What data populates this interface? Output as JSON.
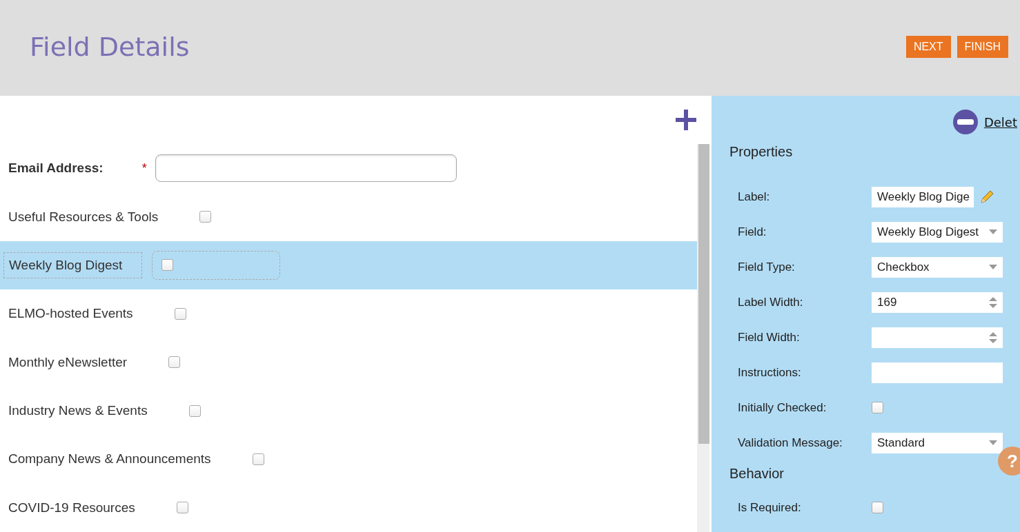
{
  "header": {
    "title": "Field Details",
    "buttons": [
      "NEXT",
      "FINISH"
    ]
  },
  "form": {
    "rows": [
      {
        "kind": "email",
        "label": "Email Address:",
        "required_mark": "*",
        "selected": false,
        "value": ""
      },
      {
        "kind": "checkbox",
        "label": "Useful Resources & Tools",
        "selected": false,
        "checked": false
      },
      {
        "kind": "checkbox",
        "label": "Weekly Blog Digest",
        "selected": true,
        "checked": false
      },
      {
        "kind": "checkbox",
        "label": "ELMO-hosted Events",
        "selected": false,
        "checked": false
      },
      {
        "kind": "checkbox",
        "label": "Monthly eNewsletter",
        "selected": false,
        "checked": false
      },
      {
        "kind": "checkbox",
        "label": "Industry News & Events",
        "selected": false,
        "checked": false
      },
      {
        "kind": "checkbox",
        "label": "Company News & Announcements",
        "selected": false,
        "checked": false
      },
      {
        "kind": "checkbox",
        "label": "COVID-19 Resources",
        "selected": false,
        "checked": false
      }
    ]
  },
  "properties_panel": {
    "delete_link": "Delet",
    "sections": [
      {
        "title": "Properties",
        "items": [
          {
            "kind": "text",
            "label": "Label:",
            "value": "Weekly Blog Dige",
            "editable": true
          },
          {
            "kind": "select",
            "label": "Field:",
            "value": "Weekly Blog Digest"
          },
          {
            "kind": "select",
            "label": "Field Type:",
            "value": "Checkbox"
          },
          {
            "kind": "number",
            "label": "Label Width:",
            "value": "169"
          },
          {
            "kind": "number",
            "label": "Field Width:",
            "value": ""
          },
          {
            "kind": "text",
            "label": "Instructions:",
            "value": ""
          },
          {
            "kind": "checkbox",
            "label": "Initially Checked:",
            "checked": false
          },
          {
            "kind": "select",
            "label": "Validation Message:",
            "value": "Standard"
          }
        ]
      },
      {
        "title": "Behavior",
        "items": [
          {
            "kind": "checkbox",
            "label": "Is Required:",
            "checked": false
          }
        ]
      }
    ]
  },
  "help_button": "?"
}
